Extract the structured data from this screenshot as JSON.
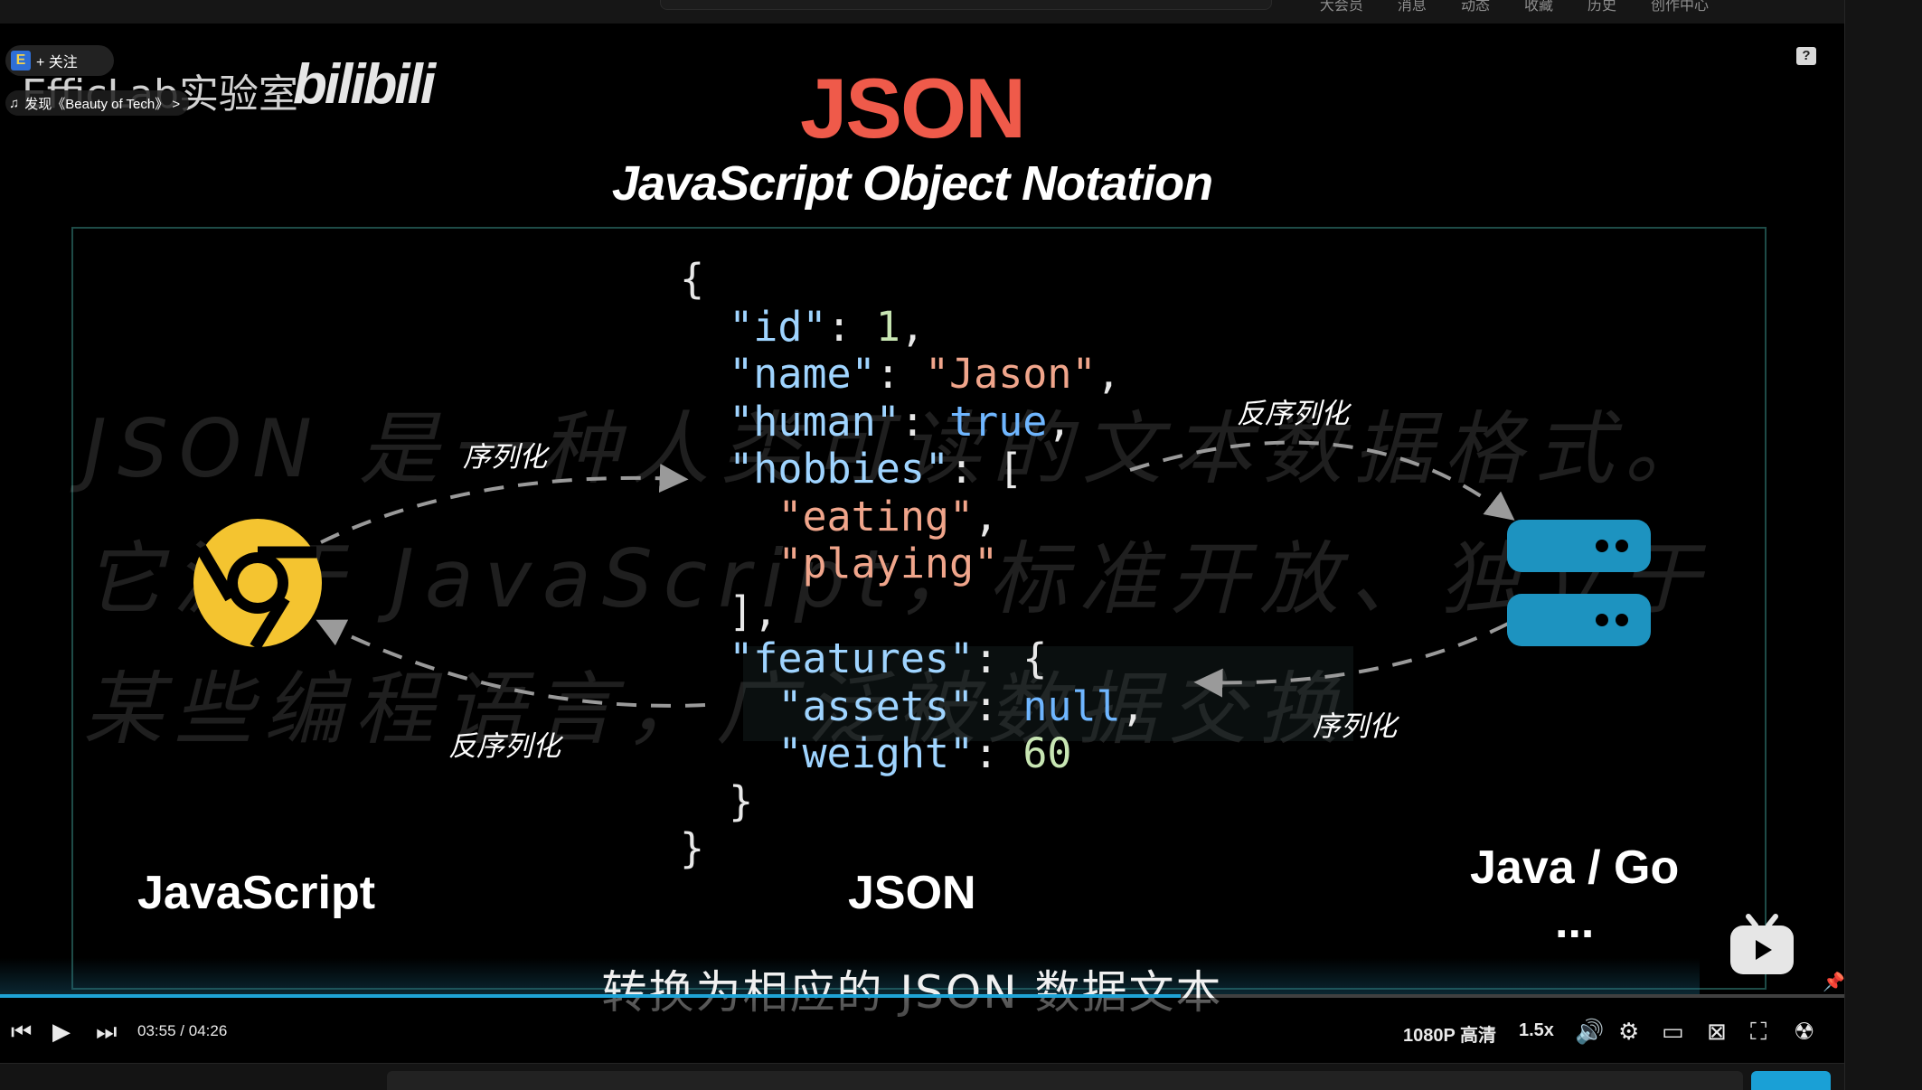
{
  "topnav": [
    "大会员",
    "消息",
    "动态",
    "收藏",
    "历史",
    "创作中心"
  ],
  "channel": {
    "logo_letter": "E",
    "follow_label": "+ 关注",
    "name": "EfficLab实验室",
    "platform_logo": "bilibili",
    "music_label": "发现《Beauty of Tech》 >"
  },
  "help_icon": "?",
  "slide": {
    "title": "JSON",
    "subtitle": "JavaScript Object Notation",
    "bg_paragraph": "JSON 是一种人类可读的文本数据格式。它源于 JavaScript，标准开放、独立于某些编程语言，广泛被数据交换",
    "code_lines": [
      [
        {
          "t": "p",
          "v": "{"
        }
      ],
      [
        {
          "t": "p",
          "v": "  "
        },
        {
          "t": "k",
          "v": "\"id\""
        },
        {
          "t": "p",
          "v": ": "
        },
        {
          "t": "n",
          "v": "1"
        },
        {
          "t": "p",
          "v": ","
        }
      ],
      [
        {
          "t": "p",
          "v": "  "
        },
        {
          "t": "k",
          "v": "\"name\""
        },
        {
          "t": "p",
          "v": ": "
        },
        {
          "t": "s",
          "v": "\"Jason\""
        },
        {
          "t": "p",
          "v": ","
        }
      ],
      [
        {
          "t": "p",
          "v": "  "
        },
        {
          "t": "k",
          "v": "\"human\""
        },
        {
          "t": "p",
          "v": ": "
        },
        {
          "t": "b",
          "v": "true"
        },
        {
          "t": "p",
          "v": ","
        }
      ],
      [
        {
          "t": "p",
          "v": "  "
        },
        {
          "t": "k",
          "v": "\"hobbies\""
        },
        {
          "t": "p",
          "v": ": ["
        }
      ],
      [
        {
          "t": "p",
          "v": "    "
        },
        {
          "t": "s",
          "v": "\"eating\""
        },
        {
          "t": "p",
          "v": ","
        }
      ],
      [
        {
          "t": "p",
          "v": "    "
        },
        {
          "t": "s",
          "v": "\"playing\""
        }
      ],
      [
        {
          "t": "p",
          "v": "  ],"
        }
      ],
      [
        {
          "t": "p",
          "v": "  "
        },
        {
          "t": "k",
          "v": "\"features\""
        },
        {
          "t": "p",
          "v": ": {"
        }
      ],
      [
        {
          "t": "p",
          "v": "    "
        },
        {
          "t": "k",
          "v": "\"assets\""
        },
        {
          "t": "p",
          "v": ": "
        },
        {
          "t": "b",
          "v": "null"
        },
        {
          "t": "p",
          "v": ","
        }
      ],
      [
        {
          "t": "p",
          "v": "    "
        },
        {
          "t": "k",
          "v": "\"weight\""
        },
        {
          "t": "p",
          "v": ": "
        },
        {
          "t": "n",
          "v": "60"
        }
      ],
      [
        {
          "t": "p",
          "v": "  }"
        }
      ],
      [
        {
          "t": "p",
          "v": "}"
        }
      ]
    ],
    "labels": {
      "serialize_left": "序列化",
      "deserialize_left": "反序列化",
      "deserialize_right": "反序列化",
      "serialize_right": "序列化"
    },
    "bottom_labels": {
      "left": "JavaScript",
      "center": "JSON",
      "right_line1": "Java / Go",
      "right_line2": "..."
    },
    "icons": {
      "left": "chrome-icon",
      "right": "server-icon"
    },
    "colors": {
      "title": "#ef5a4a",
      "chrome": "#f4c430",
      "server": "#1d93c0",
      "key": "#9fd4ff",
      "string": "#f0a58b",
      "number": "#c8e6b3",
      "keyword": "#6fb6ff"
    }
  },
  "caption": "转换为相应的 JSON 数据文本",
  "player": {
    "current_time": "03:55",
    "separator": "/",
    "total_time": "04:26",
    "progress": 0.64,
    "quality": "1080P 高清",
    "speed": "1.5x",
    "accent": "#1fa3d6"
  }
}
